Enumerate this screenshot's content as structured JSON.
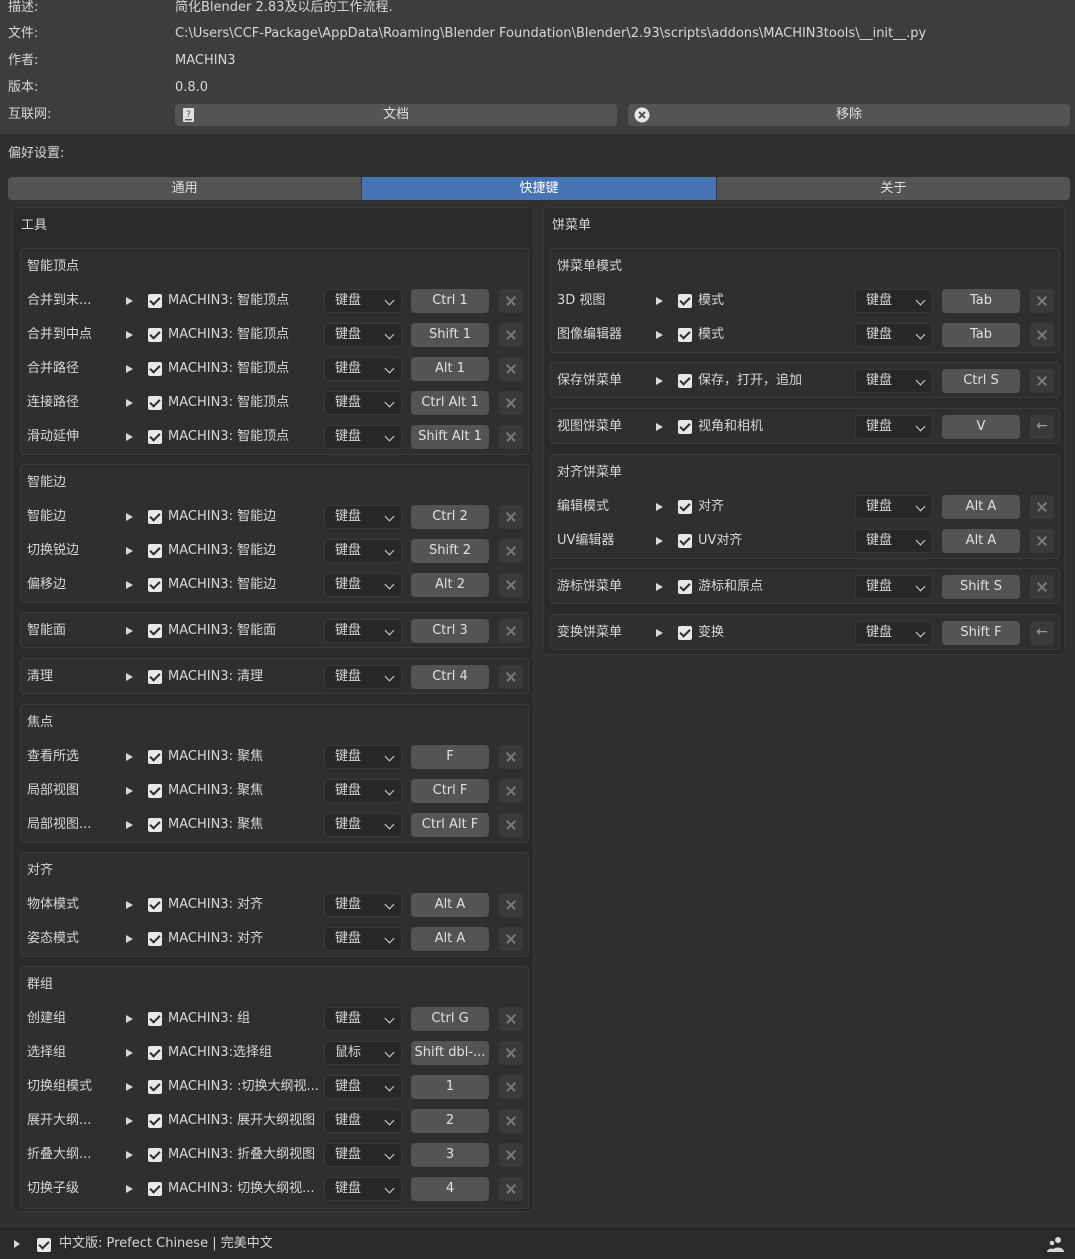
{
  "info": {
    "description_label": "描述:",
    "description_value": "简化Blender 2.83及以后的工作流程.",
    "file_label": "文件:",
    "file_value": "C:\\Users\\CCF-Package\\AppData\\Roaming\\Blender Foundation\\Blender\\2.93\\scripts\\addons\\MACHIN3tools\\__init__.py",
    "author_label": "作者:",
    "author_value": "MACHIN3",
    "version_label": "版本:",
    "version_value": "0.8.0",
    "internet_label": "互联网:",
    "docs_button": "文档",
    "remove_button": "移除"
  },
  "preferences_label": "偏好设置:",
  "tabs": [
    "通用",
    "快捷键",
    "关于"
  ],
  "active_tab": "快捷键",
  "tools": {
    "title": "工具",
    "groups": [
      {
        "title": "智能顶点",
        "rows": [
          {
            "name": "合并到末...",
            "op": "MACHIN3: 智能顶点",
            "type": "键盘",
            "key": "Ctrl 1"
          },
          {
            "name": "合并到中点",
            "op": "MACHIN3: 智能顶点",
            "type": "键盘",
            "key": "Shift 1"
          },
          {
            "name": "合并路径",
            "op": "MACHIN3: 智能顶点",
            "type": "键盘",
            "key": "Alt 1"
          },
          {
            "name": "连接路径",
            "op": "MACHIN3: 智能顶点",
            "type": "键盘",
            "key": "Ctrl Alt 1"
          },
          {
            "name": "滑动延伸",
            "op": "MACHIN3: 智能顶点",
            "type": "键盘",
            "key": "Shift Alt 1"
          }
        ]
      },
      {
        "title": "智能边",
        "rows": [
          {
            "name": "智能边",
            "op": "MACHIN3: 智能边",
            "type": "键盘",
            "key": "Ctrl 2"
          },
          {
            "name": "切换锐边",
            "op": "MACHIN3: 智能边",
            "type": "键盘",
            "key": "Shift 2"
          },
          {
            "name": "偏移边",
            "op": "MACHIN3: 智能边",
            "type": "键盘",
            "key": "Alt 2"
          }
        ]
      },
      {
        "title": "",
        "rows": [
          {
            "name": "智能面",
            "op": "MACHIN3: 智能面",
            "type": "键盘",
            "key": "Ctrl 3"
          }
        ]
      },
      {
        "title": "",
        "rows": [
          {
            "name": "清理",
            "op": "MACHIN3: 清理",
            "type": "键盘",
            "key": "Ctrl 4"
          }
        ]
      },
      {
        "title": "焦点",
        "rows": [
          {
            "name": "查看所选",
            "op": "MACHIN3: 聚焦",
            "type": "键盘",
            "key": "F"
          },
          {
            "name": "局部视图",
            "op": "MACHIN3: 聚焦",
            "type": "键盘",
            "key": "Ctrl F"
          },
          {
            "name": "局部视图...",
            "op": "MACHIN3: 聚焦",
            "type": "键盘",
            "key": "Ctrl Alt F"
          }
        ]
      },
      {
        "title": "对齐",
        "rows": [
          {
            "name": "物体模式",
            "op": "MACHIN3: 对齐",
            "type": "键盘",
            "key": "Alt A"
          },
          {
            "name": "姿态模式",
            "op": "MACHIN3: 对齐",
            "type": "键盘",
            "key": "Alt A"
          }
        ]
      },
      {
        "title": "群组",
        "rows": [
          {
            "name": "创建组",
            "op": "MACHIN3: 组",
            "type": "键盘",
            "key": "Ctrl G"
          },
          {
            "name": "选择组",
            "op": "MACHIN3:选择组",
            "type": "鼠标",
            "key": "Shift dbl-..."
          },
          {
            "name": "切换组模式",
            "op": "MACHIN3: :切换大纲视...",
            "type": "键盘",
            "key": "1"
          },
          {
            "name": "展开大纲...",
            "op": "MACHIN3: 展开大纲视图",
            "type": "键盘",
            "key": "2"
          },
          {
            "name": "折叠大纲...",
            "op": "MACHIN3: 折叠大纲视图",
            "type": "键盘",
            "key": "3"
          },
          {
            "name": "切换子级",
            "op": "MACHIN3: 切换大纲视...",
            "type": "键盘",
            "key": "4"
          }
        ]
      }
    ]
  },
  "pies": {
    "title": "饼菜单",
    "groups": [
      {
        "title": "饼菜单模式",
        "rows": [
          {
            "name": "3D 视图",
            "op": "模式",
            "type": "键盘",
            "key": "Tab",
            "action": "remove"
          },
          {
            "name": "图像编辑器",
            "op": "模式",
            "type": "键盘",
            "key": "Tab",
            "action": "remove"
          }
        ]
      },
      {
        "title": "",
        "rows": [
          {
            "name": "保存饼菜单",
            "op": "保存，打开，追加",
            "type": "键盘",
            "key": "Ctrl S",
            "action": "remove"
          }
        ]
      },
      {
        "title": "",
        "rows": [
          {
            "name": "视图饼菜单",
            "op": "视角和相机",
            "type": "键盘",
            "key": "V",
            "action": "restore"
          }
        ]
      },
      {
        "title": "对齐饼菜单",
        "rows": [
          {
            "name": "编辑模式",
            "op": "对齐",
            "type": "键盘",
            "key": "Alt A",
            "action": "remove"
          },
          {
            "name": "UV编辑器",
            "op": "UV对齐",
            "type": "键盘",
            "key": "Alt A",
            "action": "remove"
          }
        ]
      },
      {
        "title": "",
        "rows": [
          {
            "name": "游标饼菜单",
            "op": "游标和原点",
            "type": "键盘",
            "key": "Shift S",
            "action": "remove"
          }
        ]
      },
      {
        "title": "",
        "rows": [
          {
            "name": "变换饼菜单",
            "op": "变换",
            "type": "键盘",
            "key": "Shift F",
            "action": "restore"
          }
        ]
      }
    ]
  },
  "footer": {
    "addon_name": "中文版: Prefect Chinese | 完美中文"
  },
  "colors": {
    "accent": "#4772b3",
    "background": "#303030",
    "panel": "#3d3d3d",
    "button": "#545454"
  }
}
